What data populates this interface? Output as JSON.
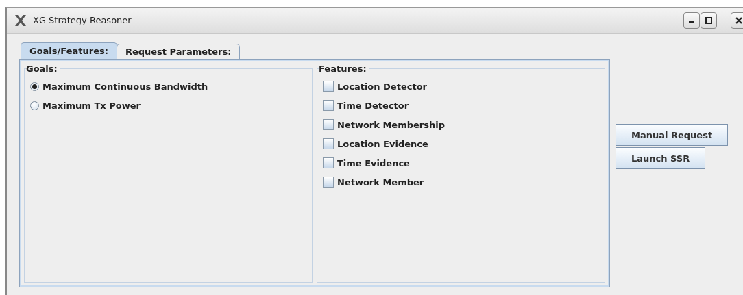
{
  "window": {
    "title": "XG Strategy Reasoner"
  },
  "tabs": [
    {
      "label": "Goals/Features:",
      "selected": true
    },
    {
      "label": "Request Parameters:",
      "selected": false
    }
  ],
  "goals": {
    "title": "Goals:",
    "options": [
      {
        "label": "Maximum Continuous Bandwidth",
        "selected": true
      },
      {
        "label": "Maximum Tx Power",
        "selected": false
      }
    ]
  },
  "features": {
    "title": "Features:",
    "items": [
      {
        "label": "Location Detector",
        "checked": false
      },
      {
        "label": "Time Detector",
        "checked": false
      },
      {
        "label": "Network Membership",
        "checked": false
      },
      {
        "label": "Location Evidence",
        "checked": false
      },
      {
        "label": "Time Evidence",
        "checked": false
      },
      {
        "label": "Network Member",
        "checked": false
      }
    ]
  },
  "buttons": [
    {
      "label": "Manual Request"
    },
    {
      "label": "Launch SSR"
    }
  ]
}
